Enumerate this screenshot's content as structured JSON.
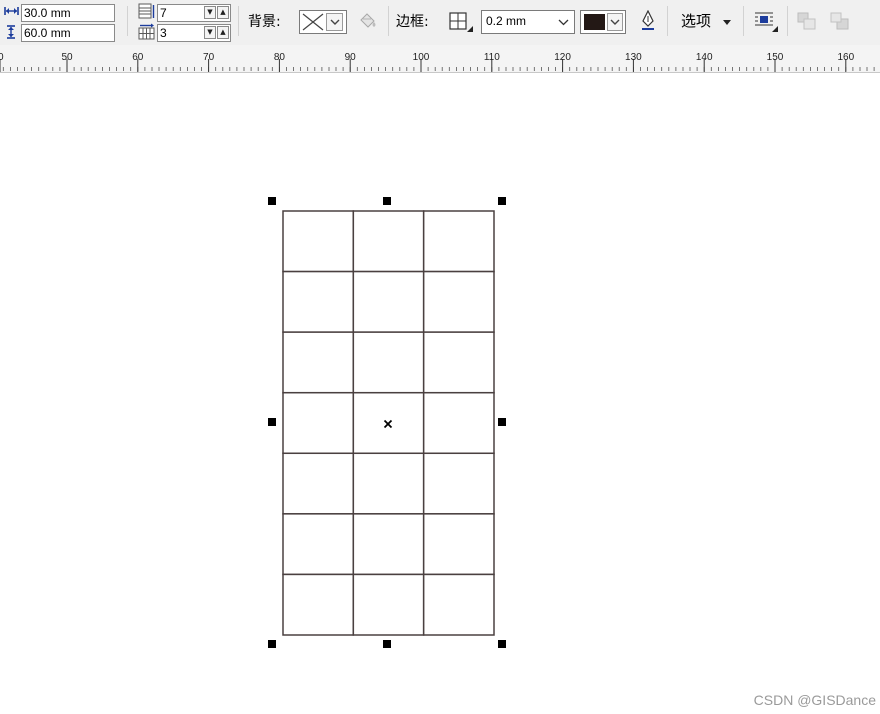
{
  "property_bar": {
    "width_value": "30.0 mm",
    "height_value": "60.0 mm",
    "rows_value": "7",
    "columns_value": "3",
    "background_label": "背景:",
    "border_label": "边框:",
    "border_width_value": "0.2 mm",
    "border_color": "#231815",
    "options_label": "选项",
    "icons": {
      "width": "width-arrow-icon",
      "height": "height-arrow-icon",
      "rows": "table-rows-icon",
      "columns": "table-columns-icon",
      "background_fill": "no-fill-icon",
      "background_dropdown": "chevron-down-icon",
      "fill_bucket": "paint-bucket-icon",
      "border_select": "border-select-icon",
      "outline_pen": "outline-pen-icon",
      "text_wrap": "wrap-text-icon",
      "bring_forward": "bring-forward-icon",
      "send_backward": "send-backward-icon"
    }
  },
  "ruler": {
    "unit": "mm",
    "labels": [
      "0",
      "50",
      "60",
      "70",
      "80",
      "90",
      "100",
      "110",
      "120",
      "130",
      "140",
      "150",
      "160"
    ]
  },
  "table": {
    "rows": 7,
    "columns": 3,
    "line_color": "#4a4040"
  },
  "watermark": "CSDN @GISDance"
}
